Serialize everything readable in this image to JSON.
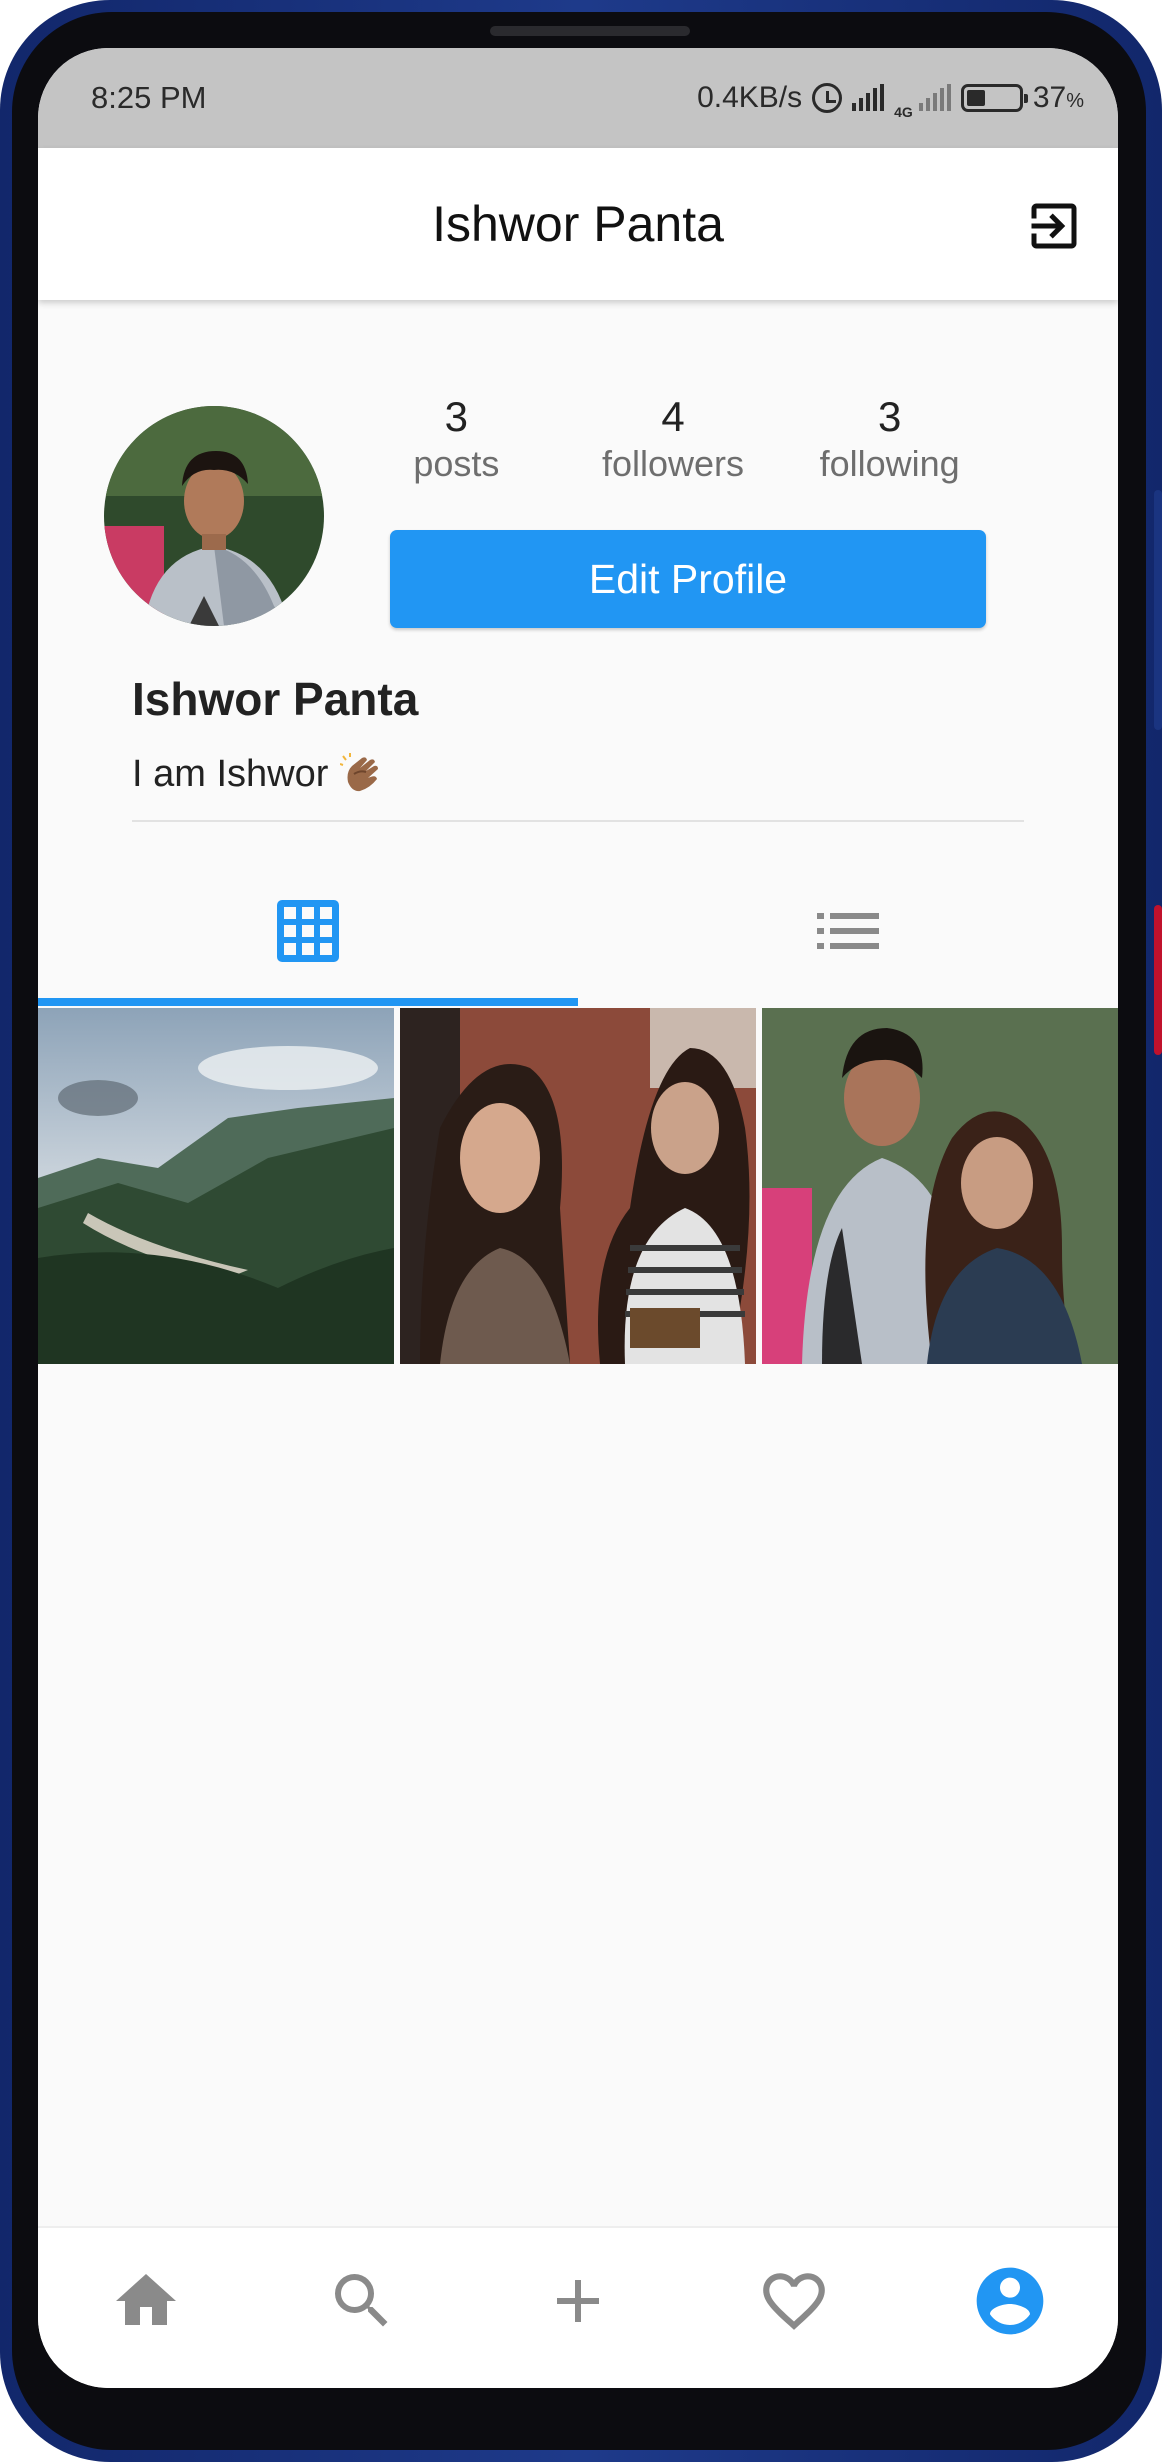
{
  "status_bar": {
    "time": "8:25 PM",
    "net_speed": "0.4KB/s",
    "network_type": "4G",
    "battery_percent": "37",
    "battery_unit": "%",
    "battery_level": 0.37
  },
  "app_bar": {
    "title": "Ishwor Panta",
    "action_icon": "logout-icon"
  },
  "profile": {
    "stats": [
      {
        "value": "3",
        "label": "posts"
      },
      {
        "value": "4",
        "label": "followers"
      },
      {
        "value": "3",
        "label": "following"
      }
    ],
    "edit_button_label": "Edit Profile",
    "display_name": "Ishwor Panta",
    "bio_text": "I am Ishwor",
    "bio_emoji": "clapping-hands-icon"
  },
  "tabs": [
    {
      "icon": "grid-icon",
      "active": true
    },
    {
      "icon": "list-icon",
      "active": false
    }
  ],
  "posts": [
    {
      "description": "mountain valley landscape"
    },
    {
      "description": "two women selfie"
    },
    {
      "description": "man and woman portrait"
    }
  ],
  "bottom_nav": [
    {
      "icon": "home-icon",
      "active": false
    },
    {
      "icon": "search-icon",
      "active": false
    },
    {
      "icon": "add-icon",
      "active": false
    },
    {
      "icon": "heart-icon",
      "active": false
    },
    {
      "icon": "account-icon",
      "active": true
    }
  ],
  "colors": {
    "accent": "#2196f3",
    "inactive_icon": "#8a8a8a",
    "status_bar_bg": "#c4c4c4",
    "background": "#fafafa"
  }
}
